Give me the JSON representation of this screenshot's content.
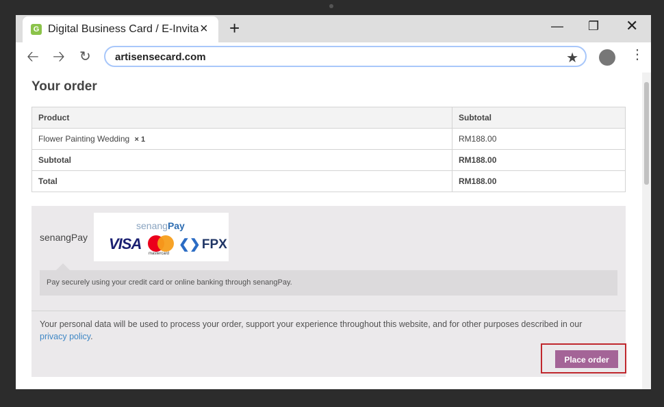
{
  "browser": {
    "tab_title": "Digital Business Card / E-Invita",
    "favicon_letter": "G",
    "close_icon": "×",
    "new_tab_icon": "+",
    "url": "artisensecard.com"
  },
  "page": {
    "heading": "Your order",
    "table": {
      "headers": [
        "Product",
        "Subtotal"
      ],
      "item": {
        "name": "Flower Painting Wedding",
        "qty": "× 1",
        "subtotal": "RM188.00"
      },
      "subtotal_row": {
        "label": "Subtotal",
        "value": "RM188.00"
      },
      "total_row": {
        "label": "Total",
        "value": "RM188.00"
      }
    },
    "payment": {
      "method_label": "senangPay",
      "logo_senang": "senang",
      "logo_pay": "Pay",
      "logo_visa": "VISA",
      "logo_mastercard": "mastercard",
      "logo_fpx": "FPX",
      "description": "Pay securely using your credit card or online banking through senangPay."
    },
    "privacy_text": "Your personal data will be used to process your order, support your experience throughout this website, and for other purposes described in our",
    "privacy_link": "privacy policy",
    "privacy_end": ".",
    "place_order_label": "Place order"
  },
  "colors": {
    "accent_button": "#a46497",
    "highlight_border": "#c0272d",
    "link": "#3f87c5"
  }
}
